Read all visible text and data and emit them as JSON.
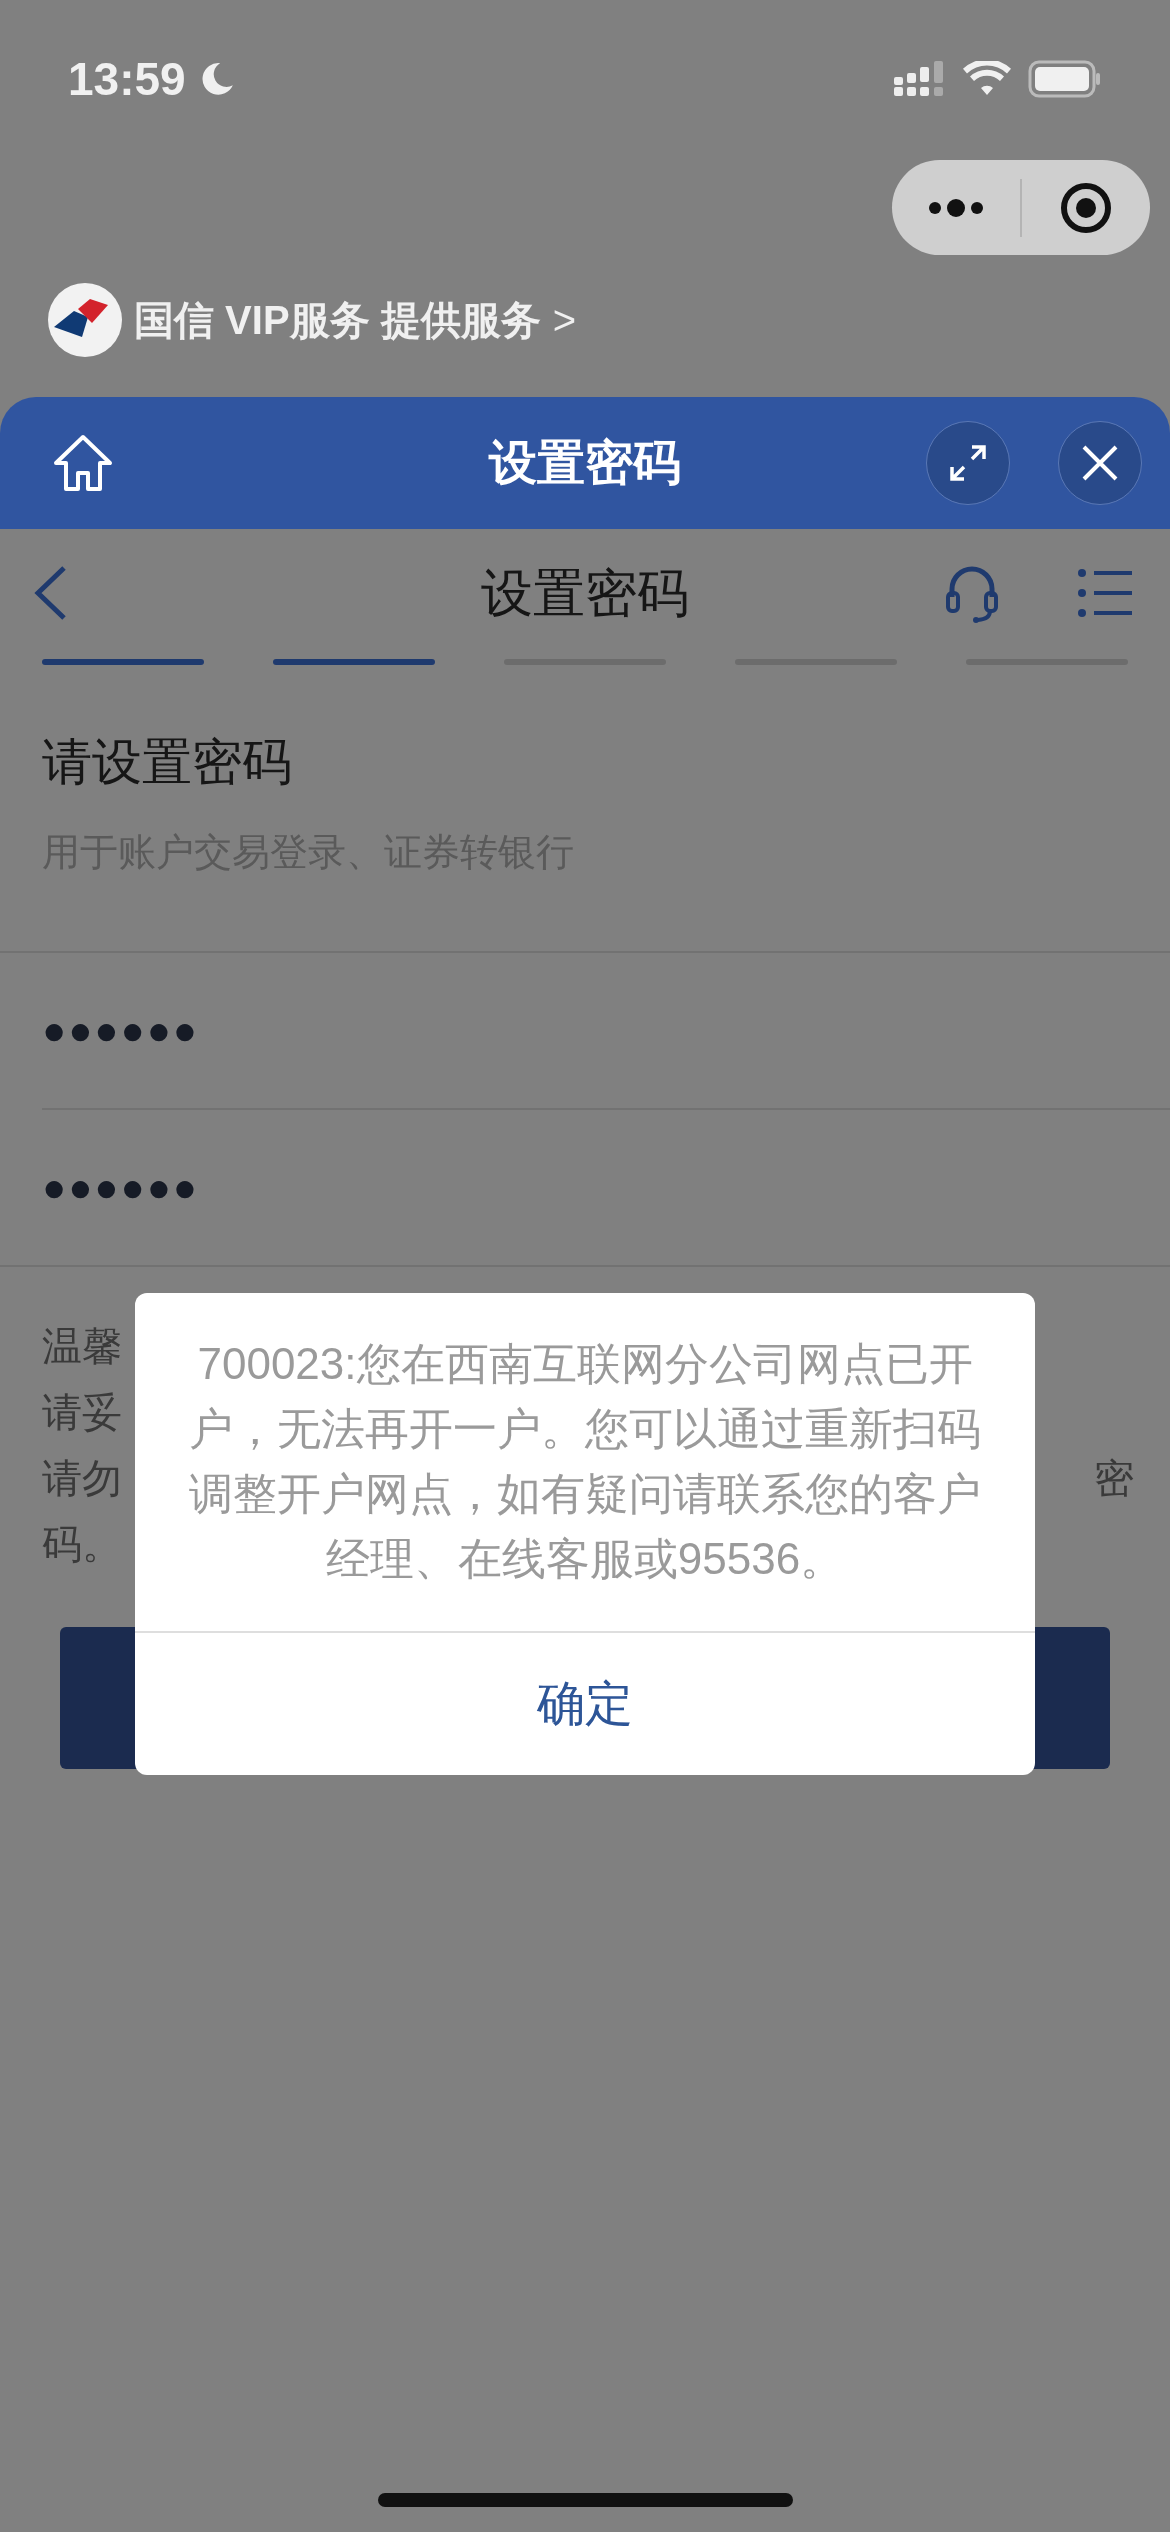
{
  "status_bar": {
    "time": "13:59"
  },
  "service_row": {
    "label": "国信 VIP服务 提供服务",
    "chevron": ">"
  },
  "sheet_header": {
    "title": "设置密码"
  },
  "nav": {
    "title": "设置密码"
  },
  "steps": [
    {
      "done": true
    },
    {
      "done": true
    },
    {
      "done": false
    },
    {
      "done": false
    },
    {
      "done": false
    }
  ],
  "heading": "请设置密码",
  "subtitle": "用于账户交易登录、证券转银行",
  "password_fields": [
    {
      "value": "●●●●●●"
    },
    {
      "value": "●●●●●●"
    }
  ],
  "notice_lines": [
    {
      "left": "温馨"
    },
    {
      "left": "请妥"
    },
    {
      "left": "请勿",
      "right": "密"
    },
    {
      "left": "码。"
    }
  ],
  "dialog": {
    "message": "700023:您在西南互联网分公司网点已开户，无法再开一户。您可以通过重新扫码调整开户网点，如有疑问请联系您的客户经理、在线客服或95536。",
    "button": "确定"
  }
}
